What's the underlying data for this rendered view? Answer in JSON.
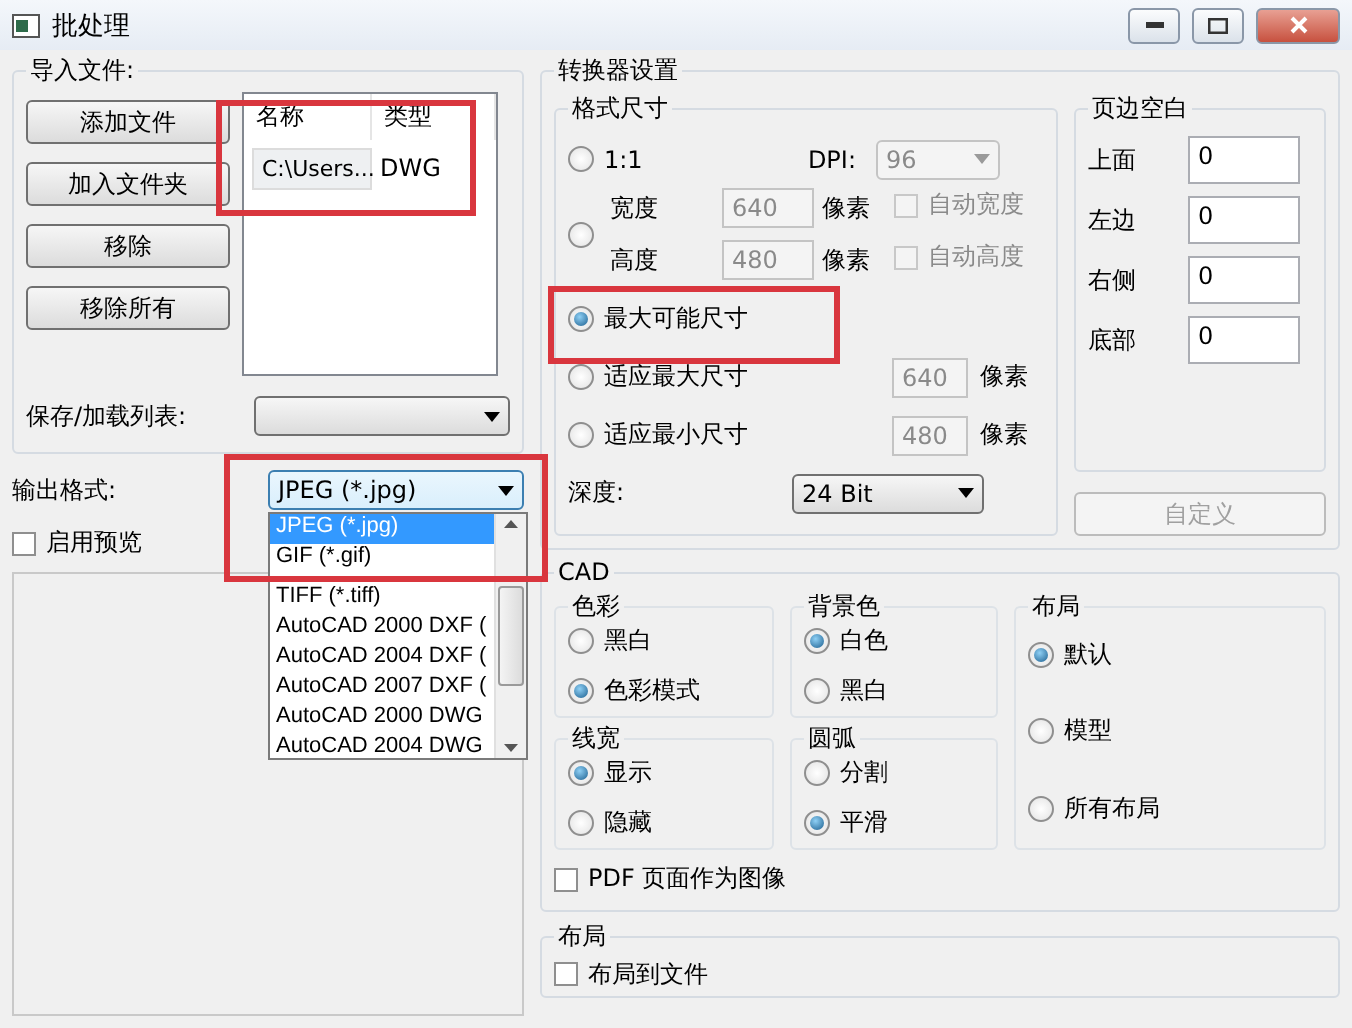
{
  "window": {
    "title": "批处理"
  },
  "import": {
    "title": "导入文件:",
    "buttons": [
      "添加文件",
      "加入文件夹",
      "移除",
      "移除所有"
    ],
    "columns": [
      "名称",
      "类型"
    ],
    "rows": [
      {
        "cells": [
          "C:\\Users...",
          "DWG"
        ],
        "highlighted": true
      }
    ]
  },
  "save_list": {
    "label": "保存/加载列表:"
  },
  "output_format": {
    "label": "输出格式:",
    "value": "JPEG (*.jpg)",
    "expanded": true,
    "highlighted": true,
    "options": [
      {
        "label": "JPEG (*.jpg)",
        "selected": true
      },
      {
        "label": "GIF (*.gif)",
        "selected": false
      },
      {
        "label": "TIFF (*.tiff)",
        "selected": false
      },
      {
        "label": "AutoCAD 2000 DXF (",
        "selected": false
      },
      {
        "label": "AutoCAD 2004 DXF (",
        "selected": false
      },
      {
        "label": "AutoCAD 2007 DXF (",
        "selected": false
      },
      {
        "label": "AutoCAD 2000 DWG",
        "selected": false
      },
      {
        "label": "AutoCAD 2004 DWG",
        "selected": false
      }
    ]
  },
  "preview": {
    "label": "启用预览",
    "checked": false
  },
  "converter": {
    "title": "转换器设置",
    "format_size": {
      "title": "格式尺寸",
      "options": [
        {
          "kind": "ratio",
          "label": "1:1",
          "selected": false,
          "disabled": true,
          "dpi_label": "DPI:",
          "dpi_value": "96"
        },
        {
          "kind": "custom",
          "selected": false,
          "disabled": true,
          "fields": [
            {
              "label": "宽度",
              "value": "640",
              "unit": "像素",
              "auto_label": "自动宽度",
              "auto_checked": false
            },
            {
              "label": "高度",
              "value": "480",
              "unit": "像素",
              "auto_label": "自动高度",
              "auto_checked": false
            }
          ]
        },
        {
          "kind": "plain",
          "label": "最大可能尺寸",
          "selected": true,
          "highlighted": true
        },
        {
          "kind": "fit",
          "label": "适应最大尺寸",
          "selected": false,
          "disabled": true,
          "value": "640",
          "unit": "像素"
        },
        {
          "kind": "fit",
          "label": "适应最小尺寸",
          "selected": false,
          "disabled": true,
          "value": "480",
          "unit": "像素"
        }
      ],
      "depth": {
        "label": "深度:",
        "value": "24 Bit"
      }
    },
    "margins": {
      "title": "页边空白",
      "fields": [
        {
          "label": "上面",
          "value": "0"
        },
        {
          "label": "左边",
          "value": "0"
        },
        {
          "label": "右侧",
          "value": "0"
        },
        {
          "label": "底部",
          "value": "0"
        }
      ],
      "button": {
        "label": "自定义",
        "disabled": true
      }
    }
  },
  "cad": {
    "title": "CAD",
    "groups": [
      {
        "title": "色彩",
        "options": [
          {
            "label": "黑白",
            "selected": false
          },
          {
            "label": "色彩模式",
            "selected": true
          }
        ]
      },
      {
        "title": "背景色",
        "options": [
          {
            "label": "白色",
            "selected": true
          },
          {
            "label": "黑白",
            "selected": false
          }
        ]
      },
      {
        "title": "布局",
        "options": [
          {
            "label": "默认",
            "selected": true
          },
          {
            "label": "模型",
            "selected": false
          },
          {
            "label": "所有布局",
            "selected": false
          }
        ]
      },
      {
        "title": "线宽",
        "options": [
          {
            "label": "显示",
            "selected": true
          },
          {
            "label": "隐藏",
            "selected": false
          }
        ]
      },
      {
        "title": "圆弧",
        "options": [
          {
            "label": "分割",
            "selected": false
          },
          {
            "label": "平滑",
            "selected": true
          }
        ]
      }
    ],
    "pdf": {
      "label": "PDF 页面作为图像",
      "checked": false
    }
  },
  "layout": {
    "title": "布局",
    "checkbox": {
      "label": "布局到文件",
      "checked": false
    }
  }
}
